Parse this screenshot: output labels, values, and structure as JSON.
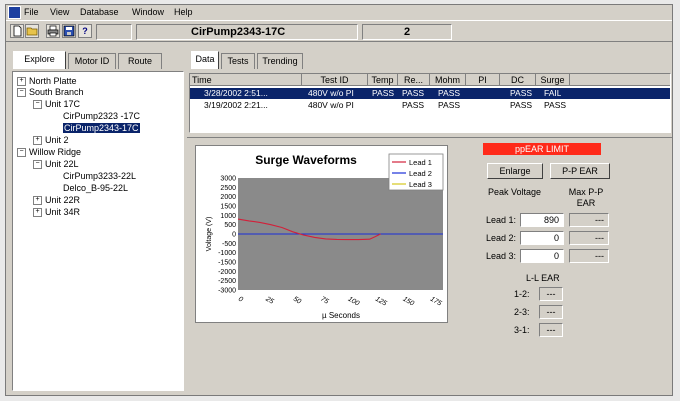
{
  "menu": [
    "File",
    "View",
    "Database",
    "Window",
    "Help"
  ],
  "toolbar": {
    "new_icon": "new-document-icon",
    "open_icon": "open-folder-icon",
    "print_icon": "printer-icon",
    "save_icon": "disk-icon",
    "help_icon": "help-icon",
    "help_glyph": "?",
    "motor_name": "CirPump2343-17C",
    "count": "2"
  },
  "left_tabs": [
    "Explore",
    "Motor ID",
    "Route"
  ],
  "tree": [
    {
      "label": "North Platte",
      "pm": "+"
    },
    {
      "label": "South Branch",
      "pm": "−"
    },
    {
      "label": "Unit 17C",
      "pm": "−"
    },
    {
      "label": "CirPump2323 -17C",
      "pm": ""
    },
    {
      "label": "CirPump2343-17C",
      "pm": ""
    },
    {
      "label": "Unit 2",
      "pm": "+"
    },
    {
      "label": "Willow Ridge",
      "pm": "−"
    },
    {
      "label": "Unit 22L",
      "pm": "−"
    },
    {
      "label": "CirPump3233-22L",
      "pm": ""
    },
    {
      "label": "Delco_B-95-22L",
      "pm": ""
    },
    {
      "label": "Unit 22R",
      "pm": "+"
    },
    {
      "label": "Unit 34R",
      "pm": "+"
    }
  ],
  "right_tabs": [
    "Data",
    "Tests",
    "Trending"
  ],
  "grid": {
    "headers": [
      "Time",
      "Test ID",
      "Temp",
      "Re...",
      "Mohm",
      "PI",
      "DC",
      "Surge"
    ],
    "rows": [
      [
        "3/28/2002 2:51...",
        "480V w/o PI",
        "PASS",
        "PASS",
        "PASS",
        "",
        "PASS",
        "FAIL"
      ],
      [
        "3/19/2002 2:21...",
        "480V w/o PI",
        "",
        "PASS",
        "PASS",
        "",
        "PASS",
        "PASS"
      ]
    ]
  },
  "chart_data": {
    "type": "line",
    "title": "Surge Waveforms",
    "xlabel": "µ Seconds",
    "ylabel": "Voltage (V)",
    "x_ticks": [
      "0",
      "25",
      "50",
      "75",
      "100",
      "125",
      "150",
      "175"
    ],
    "y_ticks": [
      "3000",
      "2500",
      "2000",
      "1500",
      "1000",
      "500",
      "0",
      "-500",
      "-1000",
      "-1500",
      "-2000",
      "-2500",
      "-3000"
    ],
    "xlim": [
      0,
      187
    ],
    "ylim": [
      -3000,
      3000
    ],
    "legend": "top-right",
    "series": [
      {
        "name": "Lead 1",
        "color": "#d2203a",
        "x": [
          0,
          10,
          20,
          30,
          40,
          50,
          60,
          70,
          80,
          90,
          100,
          110,
          120,
          125,
          130
        ],
        "y": [
          800,
          700,
          620,
          500,
          350,
          120,
          -60,
          -180,
          -260,
          -290,
          -300,
          -300,
          -280,
          -150,
          0
        ]
      },
      {
        "name": "Lead 2",
        "color": "#1a2ed8",
        "x": [
          0,
          187
        ],
        "y": [
          0,
          0
        ]
      },
      {
        "name": "Lead 3",
        "color": "#d6c81e",
        "x": [
          0,
          187
        ],
        "y": [
          0,
          0
        ]
      }
    ]
  },
  "panel": {
    "alarm": "ppEAR LIMIT",
    "alarm_color": "#ff2a1a",
    "enlarge": "Enlarge",
    "ppear": "P-P EAR",
    "peak_voltage": "Peak Voltage",
    "max_pp_ear": "Max P-P EAR",
    "leads": [
      {
        "label": "Lead 1:",
        "value": "890",
        "ear": "---"
      },
      {
        "label": "Lead 2:",
        "value": "0",
        "ear": "---"
      },
      {
        "label": "Lead 3:",
        "value": "0",
        "ear": "---"
      }
    ],
    "ll_ear": "L-L EAR",
    "ll": [
      {
        "label": "1-2:",
        "value": "---"
      },
      {
        "label": "2-3:",
        "value": "---"
      },
      {
        "label": "3-1:",
        "value": "---"
      }
    ]
  }
}
